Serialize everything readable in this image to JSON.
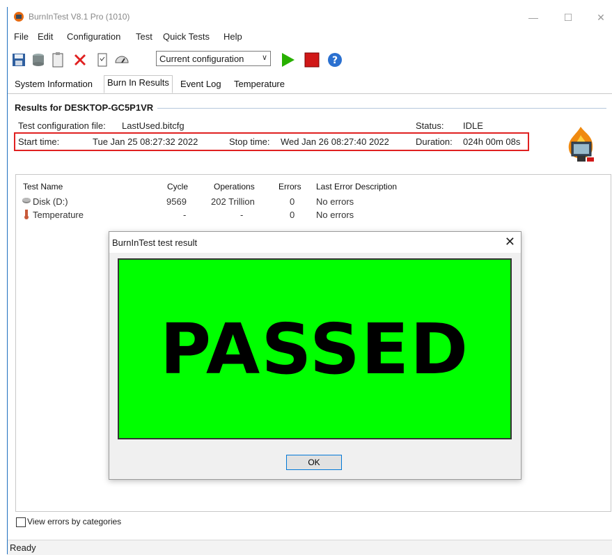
{
  "window": {
    "title": "BurnInTest V8.1 Pro (1010)"
  },
  "menu": [
    "File",
    "Edit",
    "Configuration",
    "Test",
    "Quick Tests",
    "Help"
  ],
  "toolbar": {
    "config_value": "Current configuration",
    "icons": [
      "save-icon",
      "cylinders-icon",
      "clipboard-icon",
      "delete-icon",
      "document-icon",
      "gauge-icon",
      "play-icon",
      "stop-icon",
      "help-icon"
    ]
  },
  "tabs": [
    "System Information",
    "Burn In Results",
    "Event Log",
    "Temperature"
  ],
  "results": {
    "header": "Results for DESKTOP-GC5P1VR",
    "config_label": "Test configuration file:",
    "config_file": "LastUsed.bitcfg",
    "status_label": "Status:",
    "status_value": "IDLE",
    "start_label": "Start time:",
    "start_value": "Tue Jan 25 08:27:32 2022",
    "stop_label": "Stop time:",
    "stop_value": "Wed Jan 26 08:27:40 2022",
    "duration_label": "Duration:",
    "duration_value": "024h 00m 08s"
  },
  "table": {
    "columns": [
      "Test Name",
      "Cycle",
      "Operations",
      "Errors",
      "Last Error Description"
    ],
    "rows": [
      {
        "name": "Disk (D:)",
        "cycle": "9569",
        "operations": "202 Trillion",
        "errors": "0",
        "description": "No errors"
      },
      {
        "name": "Temperature",
        "cycle": "-",
        "operations": "-",
        "errors": "0",
        "description": "No errors"
      }
    ]
  },
  "dialog": {
    "title": "BurnInTest test result",
    "result": "PASSED",
    "ok_label": "OK",
    "close_glyph": "✕"
  },
  "footer": {
    "view_errors_label": "View errors by categories",
    "status": "Ready"
  },
  "colors": {
    "passed": "#00ff00",
    "highlight": "#e02020",
    "accent": "#0078d7"
  }
}
